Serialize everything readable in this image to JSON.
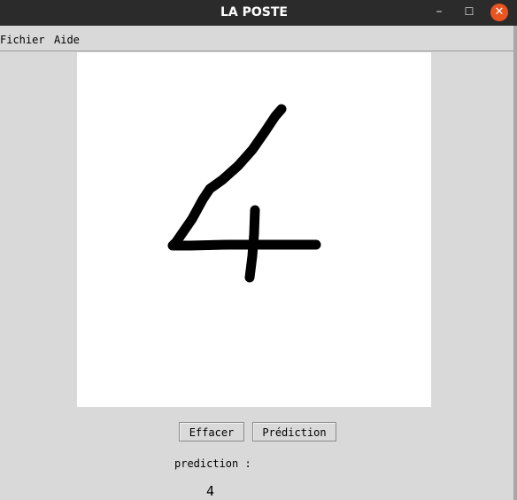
{
  "window": {
    "title": "LA POSTE",
    "controls": {
      "minimize": "–",
      "maximize": "☐",
      "close": "✕"
    }
  },
  "menu": {
    "items": [
      "Fichier",
      "Aide"
    ]
  },
  "canvas": {
    "background": "#ffffff",
    "stroke_color": "#000000"
  },
  "buttons": {
    "clear_label": "Effacer",
    "predict_label": "Prédiction"
  },
  "result": {
    "label": "prediction :",
    "value": "4"
  },
  "colors": {
    "titlebar": "#2b2b2b",
    "close_button": "#e95420",
    "background": "#d9d9d9"
  }
}
